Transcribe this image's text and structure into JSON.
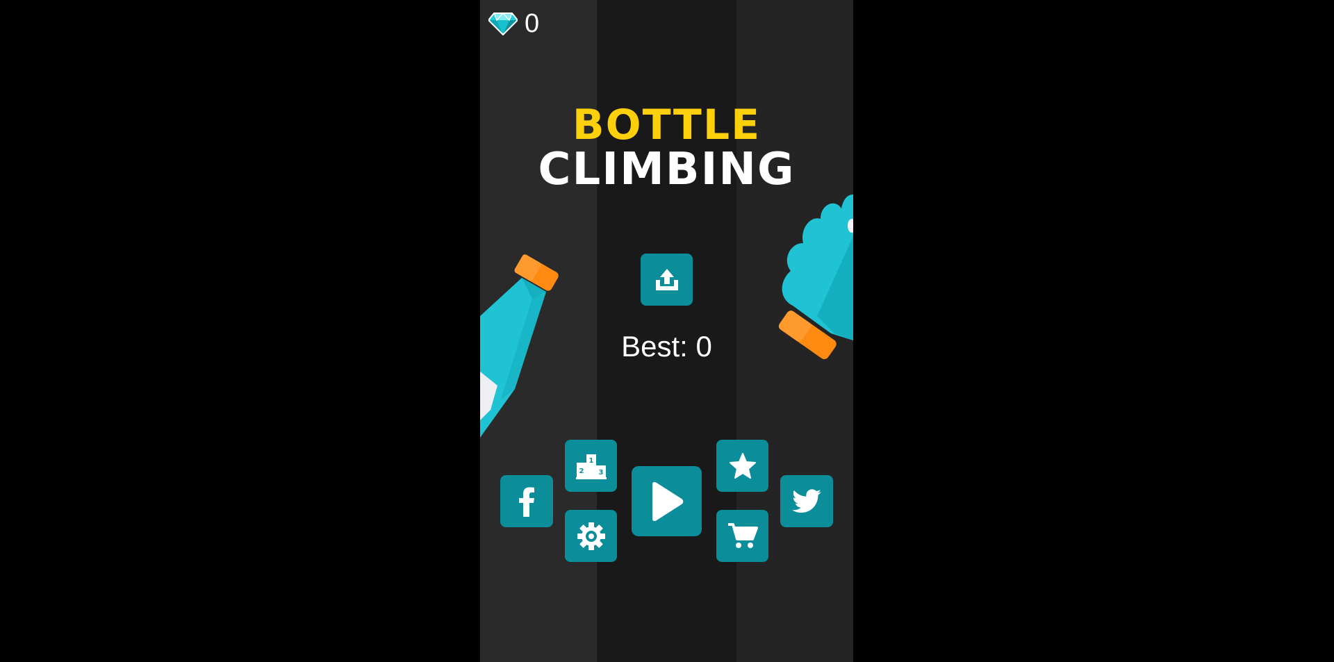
{
  "hud": {
    "gem_count": "0",
    "gem_icon": "diamond-icon"
  },
  "title": {
    "line1": "BOTTLE",
    "line2": "CLIMBING"
  },
  "best": {
    "label": "Best: 0"
  },
  "buttons": {
    "share": "share-icon",
    "facebook": "facebook-icon",
    "leaderboard": "podium-icon",
    "settings": "gear-icon",
    "play": "play-icon",
    "rate": "star-icon",
    "shop": "cart-icon",
    "twitter": "twitter-icon"
  },
  "colors": {
    "button": "#0b8e99",
    "title_top": "#fdd009",
    "bottle": "#1fc3d3",
    "cap": "#ff8a12"
  }
}
